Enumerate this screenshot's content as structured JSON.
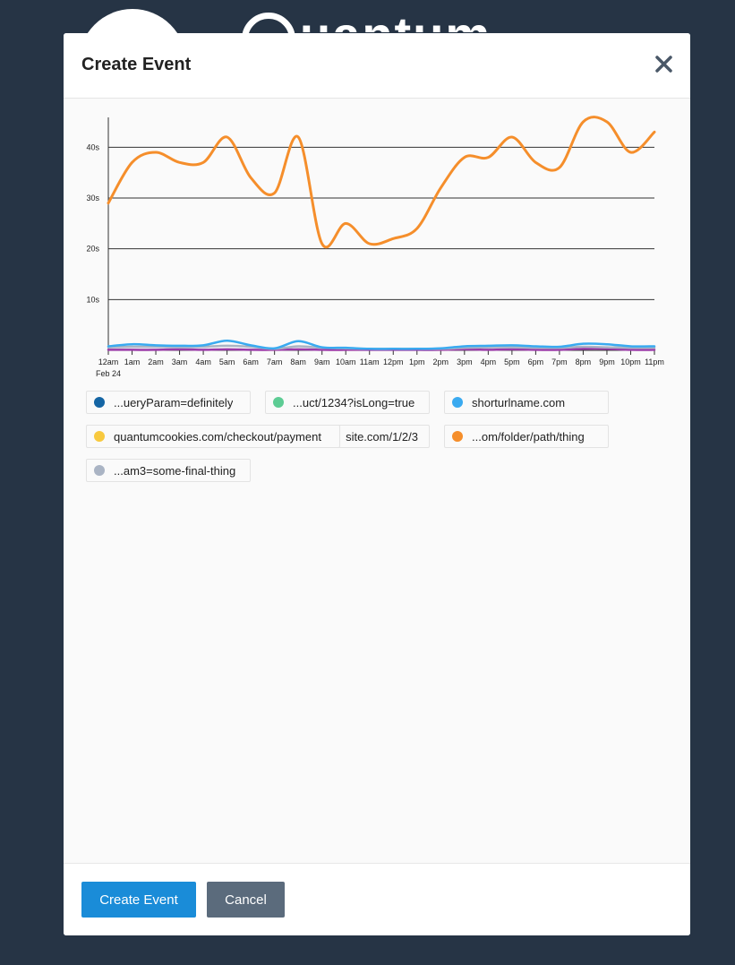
{
  "background": {
    "logo_text": "uantum"
  },
  "modal": {
    "title": "Create Event",
    "close_icon": "close-x-icon",
    "create_button": "Create Event",
    "cancel_button": "Cancel"
  },
  "legend": [
    {
      "label": "...ueryParam=definitely",
      "color": "#1465a4"
    },
    {
      "label": "...uct/1234?isLong=true",
      "color": "#5dcc94"
    },
    {
      "label": "shorturlname.com",
      "color": "#3aaaf0"
    },
    {
      "label": "quantumcookies.com/checkout/payment",
      "color": "#f8c93e"
    },
    {
      "label": "site.com/1/2/3",
      "color": "#f8c93e"
    },
    {
      "label": "...om/folder/path/thing",
      "color": "#f58e2b"
    },
    {
      "label": "...am3=some-final-thing",
      "color": "#aab4c4"
    }
  ],
  "chart_data": {
    "type": "line",
    "x": [
      "12am",
      "1am",
      "2am",
      "3am",
      "4am",
      "5am",
      "6am",
      "7am",
      "8am",
      "9am",
      "10am",
      "11am",
      "12pm",
      "1pm",
      "2pm",
      "3pm",
      "4pm",
      "5pm",
      "6pm",
      "7pm",
      "8pm",
      "9pm",
      "10pm",
      "11pm"
    ],
    "x_sublabel": "Feb 24",
    "y_ticks": [
      "10s",
      "20s",
      "30s",
      "40s"
    ],
    "ylim": [
      0,
      45
    ],
    "grid": true,
    "series": [
      {
        "color": "#f58e2b",
        "values": [
          29,
          37,
          39,
          37,
          37,
          42,
          34,
          31,
          42,
          21,
          25,
          21,
          22,
          24,
          32,
          38,
          38,
          42,
          37,
          36,
          45,
          45,
          39,
          43
        ]
      },
      {
        "color": "#3aaaf0",
        "values": [
          0.8,
          1.2,
          1.0,
          0.9,
          1.0,
          1.9,
          1.0,
          0.4,
          1.8,
          0.6,
          0.5,
          0.3,
          0.3,
          0.3,
          0.4,
          0.8,
          0.9,
          1.0,
          0.8,
          0.7,
          1.3,
          1.2,
          0.8,
          0.8
        ]
      },
      {
        "color": "#aab4c4",
        "values": [
          0.6,
          0.7,
          0.7,
          0.6,
          0.7,
          0.9,
          0.7,
          0.3,
          0.8,
          0.5,
          0.4,
          0.3,
          0.3,
          0.3,
          0.3,
          0.5,
          0.6,
          0.6,
          0.5,
          0.5,
          0.7,
          0.6,
          0.5,
          0.5
        ]
      },
      {
        "color": "#9b3aa8",
        "values": [
          0.1,
          0.1,
          0.1,
          0.2,
          0.1,
          0.2,
          0.1,
          0.1,
          0.2,
          0.1,
          0.1,
          0.1,
          0.1,
          0.1,
          0.1,
          0.2,
          0.1,
          0.2,
          0.1,
          0.1,
          0.3,
          0.3,
          0.1,
          0.1
        ]
      }
    ]
  }
}
